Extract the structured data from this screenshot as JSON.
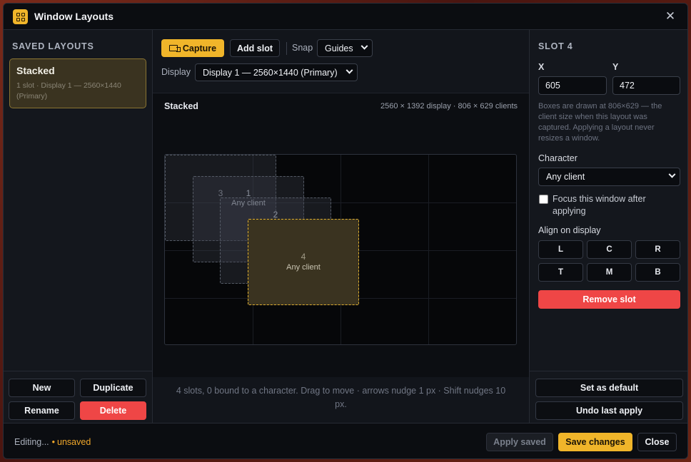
{
  "window": {
    "title": "Window Layouts",
    "close_glyph": "✕"
  },
  "left": {
    "heading": "SAVED LAYOUTS",
    "layouts": [
      {
        "name": "Stacked",
        "meta": "1 slot · Display 1 — 2560×1440 (Primary)"
      }
    ],
    "actions": {
      "new": "New",
      "duplicate": "Duplicate",
      "rename": "Rename",
      "delete": "Delete"
    }
  },
  "toolbar": {
    "capture": "Capture",
    "add_slot": "Add slot",
    "snap_label": "Snap",
    "snap_value": "Guides",
    "display_label": "Display",
    "display_value": "Display 1 — 2560×1440 (Primary)"
  },
  "canvas": {
    "layout_name": "Stacked",
    "info": "2560 × 1392 display · 806 × 629 clients",
    "slots": [
      {
        "num": "1",
        "client": "Any client"
      },
      {
        "num": "2",
        "client": "Any client"
      },
      {
        "num": "3",
        "client": ""
      },
      {
        "num": "4",
        "client": "Any client"
      }
    ],
    "footer": "4 slots, 0 bound to a character. Drag to move · arrows nudge 1 px · Shift nudges 10 px."
  },
  "slot_panel": {
    "heading": "SLOT 4",
    "x_label": "X",
    "x_value": "605",
    "y_label": "Y",
    "y_value": "472",
    "hint": "Boxes are drawn at 806×629 — the client size when this layout was captured. Applying a layout never resizes a window.",
    "character_label": "Character",
    "character_value": "Any client",
    "focus_label": "Focus this window after applying",
    "focus_checked": false,
    "align_label": "Align on display",
    "align_buttons": [
      "L",
      "C",
      "R",
      "T",
      "M",
      "B"
    ],
    "remove": "Remove slot",
    "set_default": "Set as default",
    "undo": "Undo last apply"
  },
  "bottom": {
    "status_editing": "Editing...",
    "status_dot": "•",
    "status_unsaved": "unsaved",
    "apply_saved": "Apply saved",
    "save_changes": "Save changes",
    "close": "Close"
  },
  "colors": {
    "accent": "#f0b52a",
    "danger": "#ef4646",
    "background": "#12151b"
  }
}
